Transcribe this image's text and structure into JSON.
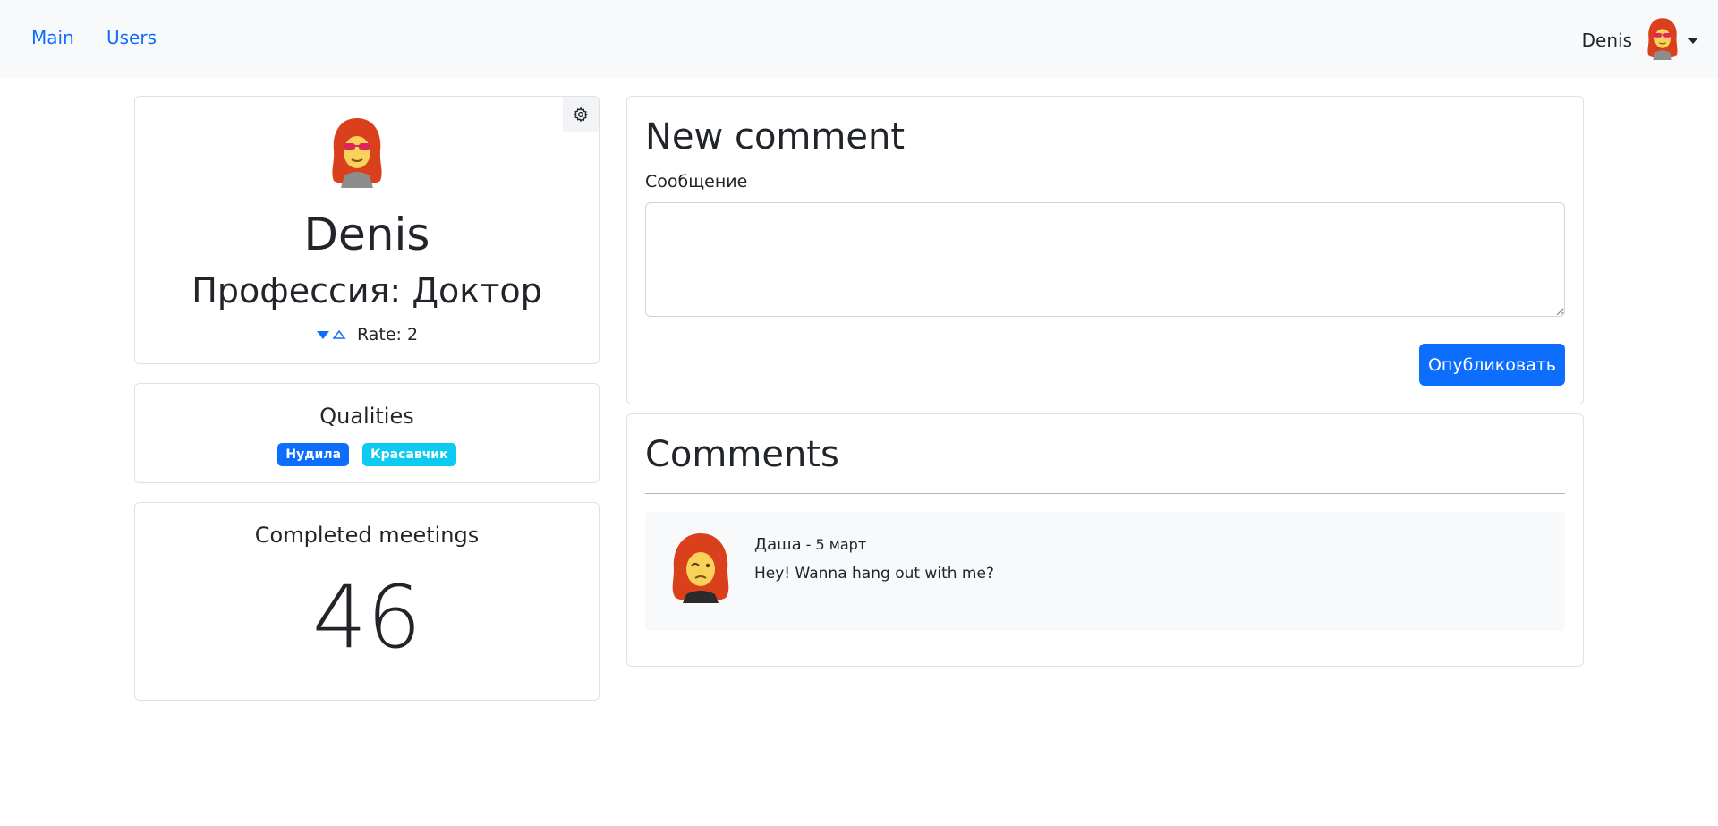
{
  "nav": {
    "links": [
      "Main",
      "Users"
    ],
    "user_name": "Denis",
    "avatar_icon": "avatar-redhead-sunglasses",
    "dropdown_icon": "caret-down-icon"
  },
  "profile": {
    "avatar_icon": "avatar-redhead-sunglasses",
    "settings_icon": "gear-icon",
    "name": "Denis",
    "profession": "Профессия: Доктор",
    "rate_label": "Rate: 2",
    "rate_down_icon": "triangle-down-filled-icon",
    "rate_up_icon": "triangle-up-outline-icon"
  },
  "qualities": {
    "title": "Qualities",
    "badges": [
      {
        "label": "Нудила",
        "color": "#0d6efd"
      },
      {
        "label": "Красавчик",
        "color": "#0dcaf0"
      }
    ]
  },
  "meetings": {
    "title": "Completed meetings",
    "count": "46"
  },
  "new_comment": {
    "title": "New comment",
    "field_label": "Сообщение",
    "textarea_value": "",
    "publish_label": "Опубликовать"
  },
  "comments": {
    "title": "Comments",
    "items": [
      {
        "author": "Даша",
        "date": " - 5 март",
        "text": "Hey! Wanna hang out with me?",
        "avatar_icon": "avatar-redhead-winking"
      }
    ]
  },
  "colors": {
    "primary": "#0d6efd",
    "info": "#0dcaf0",
    "navbar_bg": "#f8f9fa"
  }
}
